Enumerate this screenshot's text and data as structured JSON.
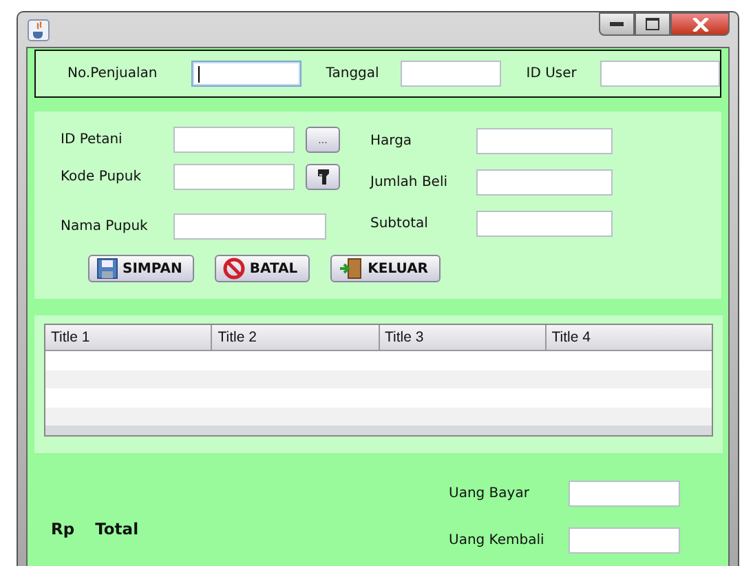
{
  "header_fields": [
    {
      "label": "No.Penjualan",
      "focused": true
    },
    {
      "label": "Tanggal",
      "focused": false
    },
    {
      "label": "ID User",
      "focused": false
    }
  ],
  "left_fields": [
    {
      "label": "ID Petani",
      "kind": "dots",
      "button_text": "..."
    },
    {
      "label": "Kode Pupuk",
      "kind": "tool"
    },
    {
      "label": "Nama Pupuk",
      "kind": "wide"
    }
  ],
  "right_fields": [
    {
      "label": "Harga"
    },
    {
      "label": "Jumlah Beli"
    },
    {
      "label": "Subtotal"
    }
  ],
  "actions": [
    {
      "label": "SIMPAN",
      "kind": "save"
    },
    {
      "label": "BATAL",
      "kind": "cancel"
    },
    {
      "label": "KELUAR",
      "kind": "exit"
    }
  ],
  "table": {
    "columns": [
      "Title 1",
      "Title 2",
      "Title 3",
      "Title 4"
    ]
  },
  "total": {
    "currency": "Rp",
    "label": "Total"
  },
  "payment_fields": [
    {
      "label": "Uang Bayar"
    },
    {
      "label": "Uang Kembali"
    }
  ]
}
